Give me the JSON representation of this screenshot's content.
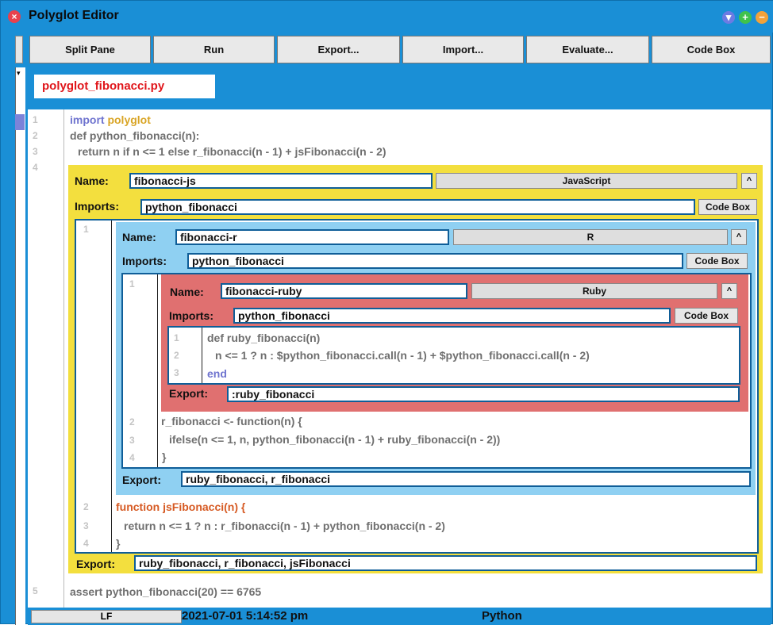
{
  "window": {
    "title": "Polyglot Editor"
  },
  "toolbar": {
    "buttons": [
      "Split Pane",
      "Run",
      "Export...",
      "Import...",
      "Evaluate...",
      "Code Box"
    ]
  },
  "tab": {
    "filename": "polyglot_fibonacci.py"
  },
  "editor": {
    "line_numbers": [
      "1",
      "2",
      "3",
      "4",
      "5"
    ],
    "python_lines": {
      "l1a": "import",
      "l1b": "polyglot",
      "l2": "def python_fibonacci(n):",
      "l3": "return n if n <= 1 else r_fibonacci(n - 1) + jsFibonacci(n - 2)",
      "l5": "assert python_fibonacci(20) == 6765"
    }
  },
  "js_block": {
    "name_label": "Name:",
    "name": "fibonacci-js",
    "language": "JavaScript",
    "caret": "^",
    "imports_label": "Imports:",
    "imports": "python_fibonacci",
    "codebox": "Code Box",
    "export_label": "Export:",
    "export": "ruby_fibonacci, r_fibonacci, jsFibonacci",
    "line_numbers": [
      "1",
      "2",
      "3",
      "4"
    ],
    "lines": {
      "l2": "function jsFibonacci(n) {",
      "l3": "return n <= 1 ? n : r_fibonacci(n - 1) + python_fibonacci(n - 2)",
      "l4": "}"
    }
  },
  "r_block": {
    "name_label": "Name:",
    "name": "fibonacci-r",
    "language": "R",
    "caret": "^",
    "imports_label": "Imports:",
    "imports": "python_fibonacci",
    "codebox": "Code Box",
    "export_label": "Export:",
    "export": "ruby_fibonacci, r_fibonacci",
    "line_numbers": [
      "1",
      "2",
      "3",
      "4"
    ],
    "lines": {
      "l2": "r_fibonacci <- function(n) {",
      "l3": "ifelse(n <= 1, n, python_fibonacci(n - 1) + ruby_fibonacci(n - 2))",
      "l4": "}"
    }
  },
  "ruby_block": {
    "name_label": "Name:",
    "name": "fibonacci-ruby",
    "language": "Ruby",
    "caret": "^",
    "imports_label": "Imports:",
    "imports": "python_fibonacci",
    "codebox": "Code Box",
    "export_label": "Export:",
    "export": ":ruby_fibonacci",
    "line_numbers": [
      "1",
      "2",
      "3"
    ],
    "lines": {
      "l1": "def ruby_fibonacci(n)",
      "l2": "n <= 1 ? n : $python_fibonacci.call(n - 1) + $python_fibonacci.call(n - 2)",
      "l3": "end"
    }
  },
  "status": {
    "line_ending": "LF",
    "timestamp": "2021-07-01 5:14:52 pm",
    "language": "Python"
  },
  "colors": {
    "chrome": "#1a8fd6",
    "js_block": "#f3df3e",
    "r_block": "#8fd0f2",
    "ruby_block": "#e07070"
  }
}
